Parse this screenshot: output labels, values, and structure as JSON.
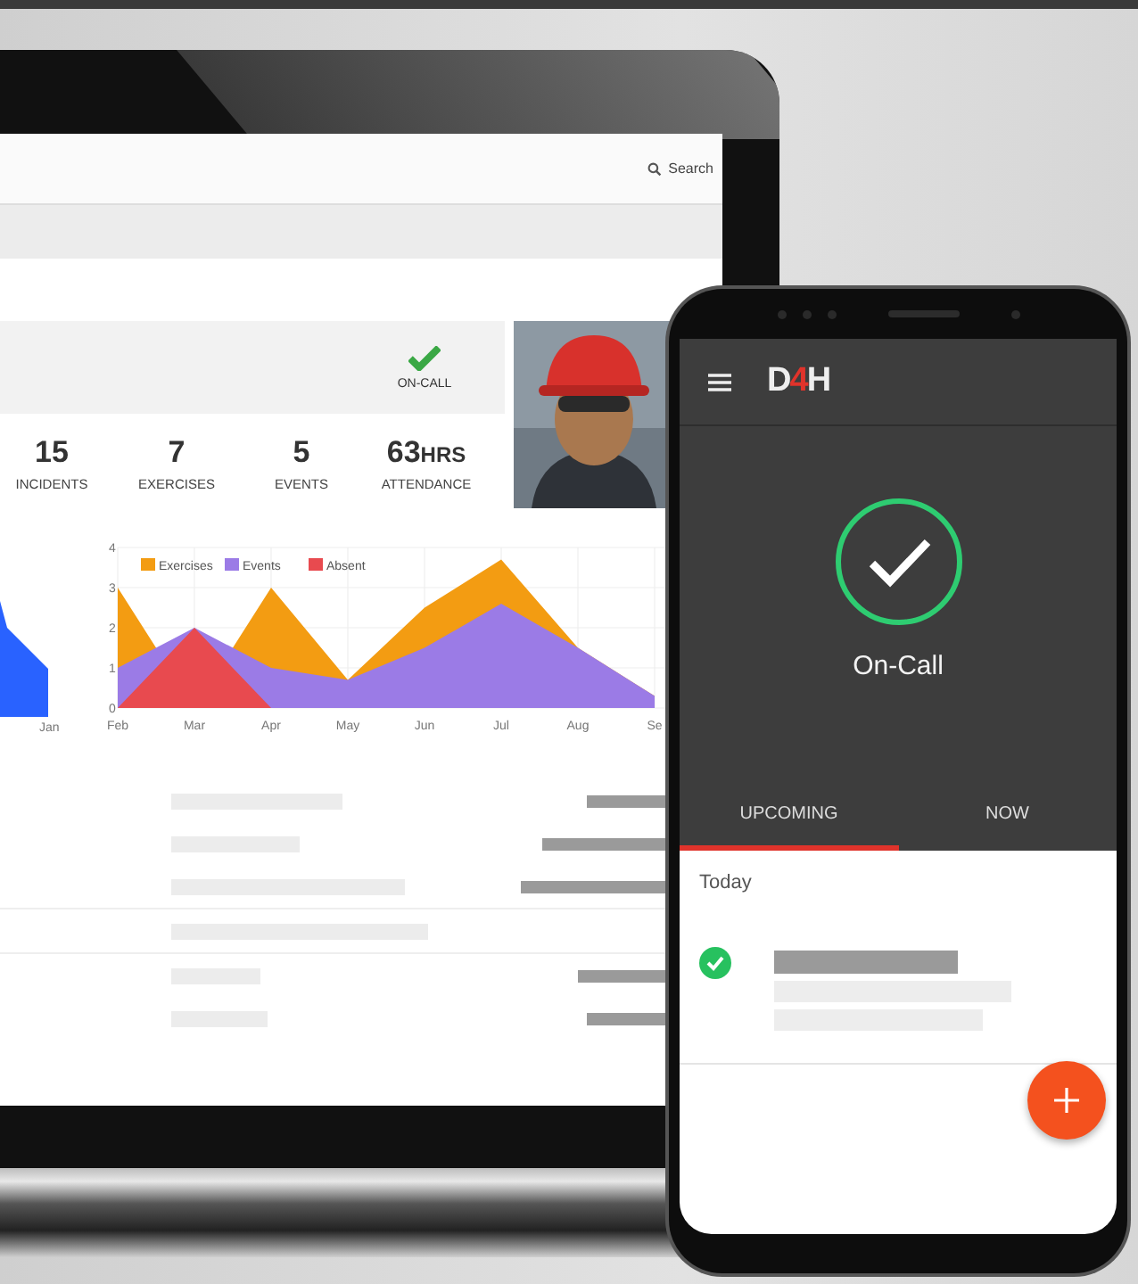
{
  "laptop": {
    "search": {
      "label": "Search"
    },
    "status": {
      "label": "ON-CALL",
      "on_call": true
    },
    "stats": [
      {
        "value": "15",
        "label": "INCIDENTS"
      },
      {
        "value": "7",
        "label": "EXERCISES"
      },
      {
        "value": "5",
        "label": "EVENTS"
      },
      {
        "value": "63",
        "unit": "HRS",
        "label": "ATTENDANCE"
      }
    ],
    "small_chart": {
      "x_label": "Jan"
    },
    "chart": {
      "chart_data": {
        "type": "area",
        "categories": [
          "Feb",
          "Mar",
          "Apr",
          "May",
          "Jun",
          "Jul",
          "Aug",
          "Se"
        ],
        "ylim": [
          0,
          4
        ],
        "yticks": [
          0,
          1,
          2,
          3,
          4
        ],
        "grid": true,
        "legend": true,
        "series": [
          {
            "name": "Exercises",
            "color": "#f39c12",
            "values": [
              3,
              null,
              3,
              0.7,
              2.5,
              3.7,
              1.5,
              0.3
            ]
          },
          {
            "name": "Events",
            "color": "#9b7be6",
            "values": [
              1,
              2,
              1,
              0.7,
              1.5,
              2.6,
              1.5,
              0.3
            ]
          },
          {
            "name": "Absent",
            "color": "#e84a4f",
            "values": [
              0,
              2,
              0,
              0,
              0,
              0,
              0,
              0
            ]
          }
        ]
      }
    }
  },
  "phone": {
    "logo": [
      {
        "text": "D",
        "accent": false
      },
      {
        "text": "4",
        "accent": true
      },
      {
        "text": "H",
        "accent": false
      }
    ],
    "status": {
      "label": "On-Call",
      "on_call": true
    },
    "tabs": [
      {
        "label": "UPCOMING",
        "selected": true
      },
      {
        "label": "NOW",
        "selected": false
      }
    ],
    "section": "Today",
    "items": [
      {
        "done": true
      }
    ]
  }
}
